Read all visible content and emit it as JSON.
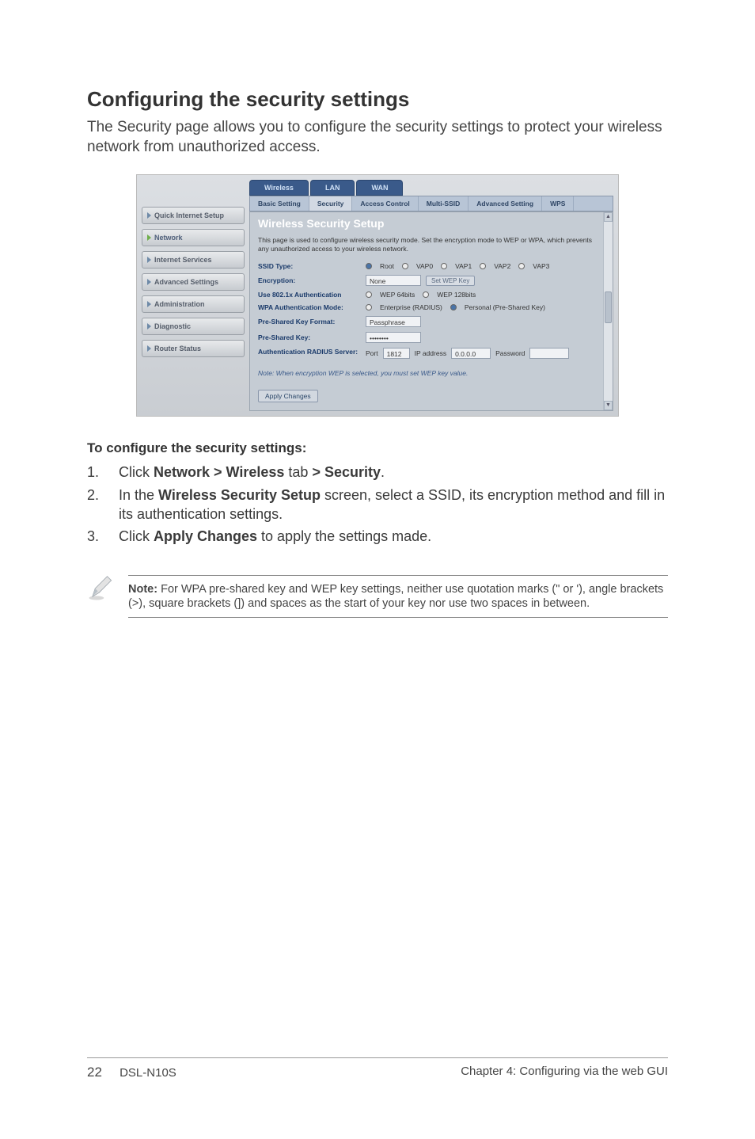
{
  "heading": "Configuring the security settings",
  "intro": "The Security page allows you to configure the security settings to protect your wireless network from unauthorized access.",
  "sidebar": {
    "items": [
      "Quick Internet Setup",
      "Network",
      "Internet Services",
      "Advanced Settings",
      "Administration",
      "Diagnostic",
      "Router Status"
    ]
  },
  "tabs_top": [
    "Wireless",
    "LAN",
    "WAN"
  ],
  "tabs_sub": [
    "Basic Setting",
    "Security",
    "Access Control",
    "Multi-SSID",
    "Advanced Setting",
    "WPS"
  ],
  "panel": {
    "title": "Wireless Security Setup",
    "desc": "This page is used to configure wireless security mode.\nSet the encryption mode to WEP or WPA, which prevents any unauthorized access to your wireless network.",
    "ssid_label": "SSID Type:",
    "ssid_options": [
      "Root",
      "VAP0",
      "VAP1",
      "VAP2",
      "VAP3"
    ],
    "encryption_label": "Encryption:",
    "encryption_value": "None",
    "set_wep_btn": "Set WEP Key",
    "use8021x_label": "Use 802.1x Authentication",
    "wep64": "WEP 64bits",
    "wep128": "WEP 128bits",
    "wpa_auth_label": "WPA Authentication Mode:",
    "wpa_opt1": "Enterprise (RADIUS)",
    "wpa_opt2": "Personal (Pre-Shared Key)",
    "psk_format_label": "Pre-Shared Key Format:",
    "psk_format_value": "Passphrase",
    "psk_label": "Pre-Shared Key:",
    "psk_value": "••••••••",
    "auth_radius_label": "Authentication RADIUS Server:",
    "port_label": "Port",
    "port_value": "1812",
    "ip_label": "IP address",
    "ip_value": "0.0.0.0",
    "password_label": "Password",
    "note_italic": "Note: When encryption WEP is selected, you must set WEP key value.",
    "apply_btn": "Apply Changes"
  },
  "instructions": {
    "title": "To configure the security settings:",
    "steps": [
      {
        "n": "1.",
        "pre": "Click ",
        "bold": "Network > Wireless",
        "mid": " tab ",
        "bold2": "> Security",
        "post": "."
      },
      {
        "n": "2.",
        "pre": "In the ",
        "bold": "Wireless Security Setup",
        "mid": " screen, select a SSID, its encryption method and fill in its authentication settings.",
        "bold2": "",
        "post": ""
      },
      {
        "n": "3.",
        "pre": "Click ",
        "bold": "Apply Changes",
        "mid": " to apply the settings made.",
        "bold2": "",
        "post": ""
      }
    ]
  },
  "note": {
    "label": "Note:",
    "text": " For WPA pre-shared key and WEP key settings, neither use quotation marks (\" or '), angle brackets (>), square brackets (]) and spaces as the start of your key nor use two spaces in between."
  },
  "footer": {
    "page": "22",
    "model": "DSL-N10S",
    "chapter": "Chapter 4: Configuring via the web GUI"
  }
}
